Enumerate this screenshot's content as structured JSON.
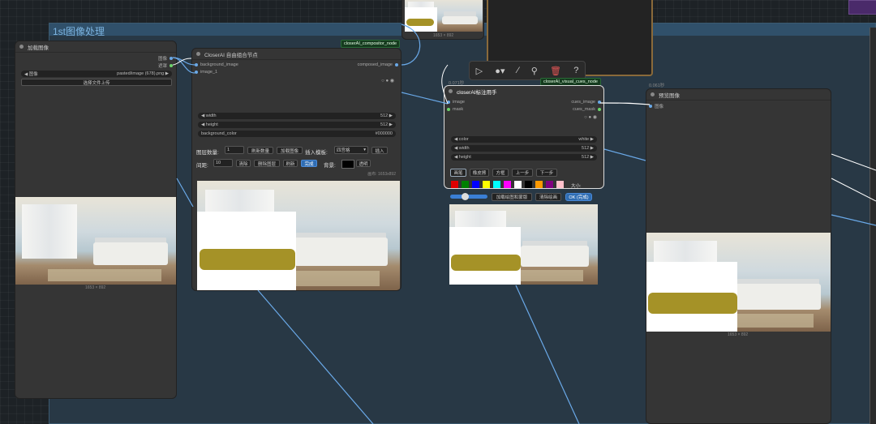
{
  "group": {
    "title": "1st图像处理"
  },
  "load_node": {
    "title": "加载图像",
    "out_image": "图像",
    "out_mask": "遮罩",
    "image_label": "图像",
    "image_value": "pasted/image (678).png",
    "upload_label": "选择文件上传",
    "dims": "1653 × 892"
  },
  "compositor_node": {
    "tag": "closerAI_compositor_node",
    "title": "CloserAI 自由组合节点",
    "in_background": "background_image",
    "in_image1": "image_1",
    "out_composed": "composed_image",
    "width_label": "width",
    "width_value": "512",
    "height_label": "height",
    "height_value": "512",
    "bgcolor_label": "background_color",
    "bgcolor_value": "#000000",
    "layer_count_label": "图层数量:",
    "layer_count_value": "1",
    "refresh_count": "刷新数量",
    "load_image": "加载图像",
    "insert_template_label": "插入模板:",
    "template_value": "四宫格",
    "insert": "插入",
    "spacing_label": "间距:",
    "spacing_value": "10",
    "clear": "清除",
    "delete_image": "删除图层",
    "refresh": "刷新",
    "done": "完成",
    "bg_label": "背景:",
    "transparent": "透明",
    "canvas_info": "画布: 1653x892"
  },
  "top_preview": {
    "dims": "1653 × 892"
  },
  "visual_cues_node": {
    "timing": "0.071秒",
    "tag": "closerAI_visual_cues_node",
    "title": "closerAI标注用手",
    "in_image": "image",
    "in_mask": "mask",
    "out_cues_image": "cues_image",
    "out_cues_mask": "cues_mask",
    "color_label": "color",
    "color_value": "white",
    "width_label": "width",
    "width_value": "512",
    "height_label": "height",
    "height_value": "512",
    "tools": [
      "画笔",
      "橡皮擦",
      "方框",
      "上一步",
      "下一步"
    ],
    "size_label": "大小:",
    "palette": [
      "#e00000",
      "#008000",
      "#0000ff",
      "#ffff00",
      "#00ffff",
      "#ff00ff",
      "#ffffff",
      "#000000",
      "#ff9900",
      "#800080",
      "#ffc0cb"
    ],
    "load_mask": "加载绘图和蒙版",
    "clear_draw": "清除绘画",
    "ok": "OK (完成)"
  },
  "preview_node": {
    "timing": "0.061秒",
    "title": "预览图像",
    "in_image": "图像",
    "dims": "1653 × 892"
  },
  "toolbar": {
    "icons": [
      "play-icon",
      "circle-icon",
      "wand-icon",
      "pin-icon",
      "trash-icon",
      "help-icon"
    ]
  }
}
